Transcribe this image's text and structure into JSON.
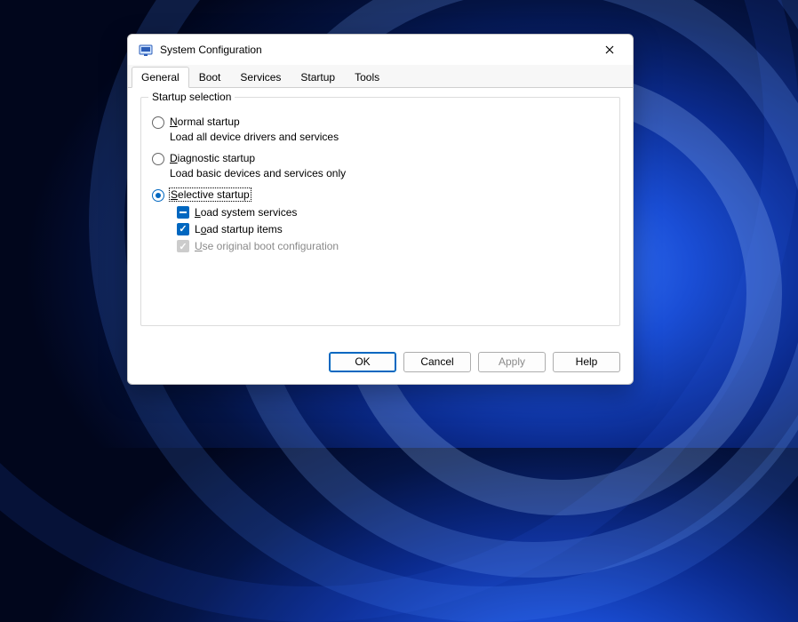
{
  "window": {
    "title": "System Configuration"
  },
  "tabs": {
    "general": "General",
    "boot": "Boot",
    "services": "Services",
    "startup": "Startup",
    "tools": "Tools"
  },
  "group": {
    "legend": "Startup selection",
    "normal": {
      "label": "Normal startup",
      "desc": "Load all device drivers and services"
    },
    "diagnostic": {
      "label": "Diagnostic startup",
      "desc": "Load basic devices and services only"
    },
    "selective": {
      "label": "Selective startup"
    },
    "checks": {
      "load_system_services": "Load system services",
      "load_startup_items": "Load startup items",
      "use_original_boot": "Use original boot configuration"
    }
  },
  "buttons": {
    "ok": "OK",
    "cancel": "Cancel",
    "apply": "Apply",
    "help": "Help"
  }
}
